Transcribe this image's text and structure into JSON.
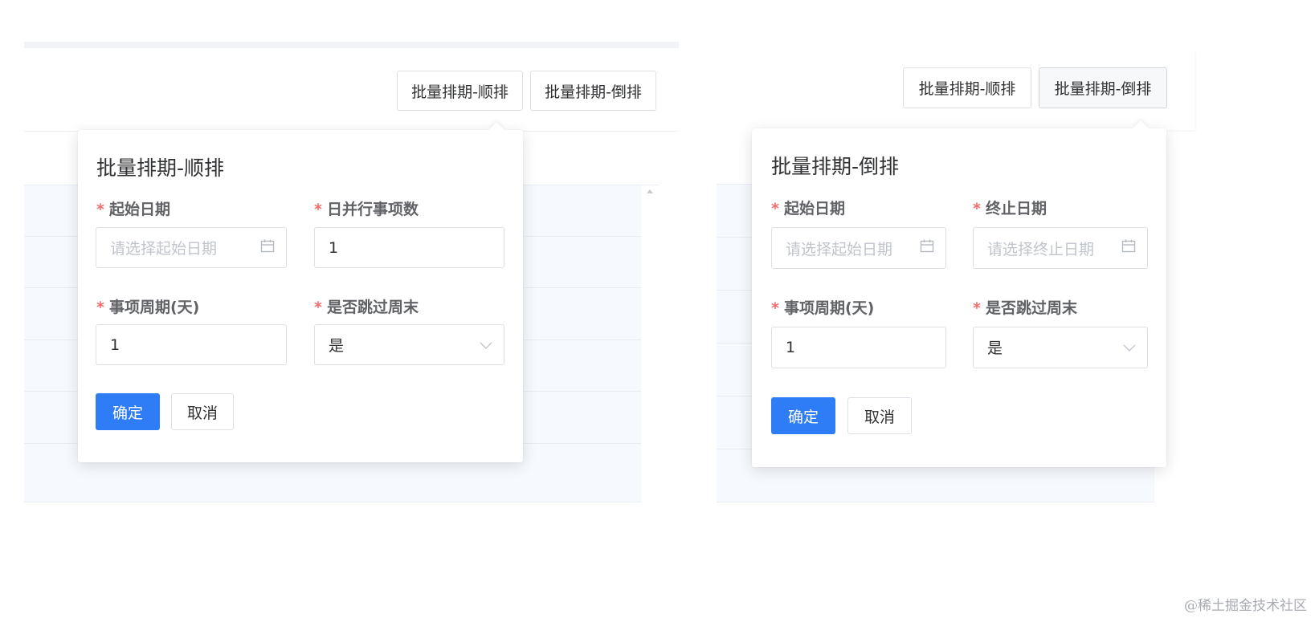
{
  "toolbar": {
    "btn_forward": "批量排期-顺排",
    "btn_reverse": "批量排期-倒排"
  },
  "popover_forward": {
    "title": "批量排期-顺排",
    "required_mark": "*",
    "start_date_label": "起始日期",
    "start_date_placeholder": "请选择起始日期",
    "daily_items_label": "日并行事项数",
    "daily_items_value": "1",
    "cycle_label": "事项周期(天)",
    "cycle_value": "1",
    "skip_weekend_label": "是否跳过周末",
    "skip_weekend_value": "是",
    "confirm": "确定",
    "cancel": "取消"
  },
  "popover_reverse": {
    "title": "批量排期-倒排",
    "required_mark": "*",
    "start_date_label": "起始日期",
    "start_date_placeholder": "请选择起始日期",
    "end_date_label": "终止日期",
    "end_date_placeholder": "请选择终止日期",
    "cycle_label": "事项周期(天)",
    "cycle_value": "1",
    "skip_weekend_label": "是否跳过周末",
    "skip_weekend_value": "是",
    "confirm": "确定",
    "cancel": "取消"
  },
  "watermark": "@稀土掘金技术社区",
  "colors": {
    "primary": "#2f7df6",
    "required": "#f56c6c",
    "border": "#dcdfe6",
    "placeholder": "#c0c4cc"
  },
  "icons": {
    "date": "calendar-icon",
    "select": "chevron-down-icon"
  }
}
